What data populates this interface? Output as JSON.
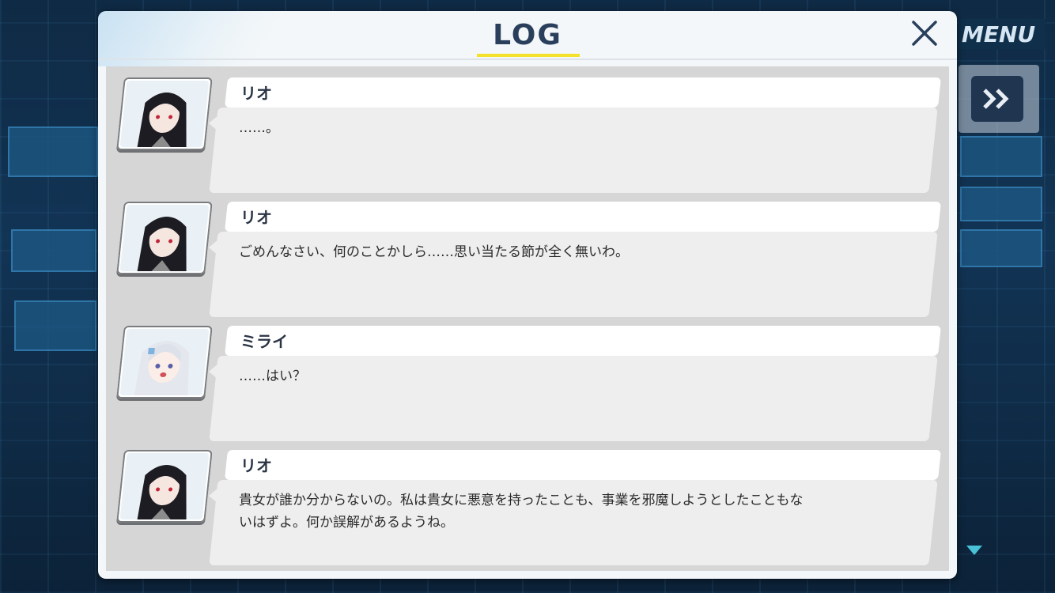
{
  "window": {
    "title": "LOG",
    "close_icon": "close-icon",
    "accent_color": "#f3e12c"
  },
  "background": {
    "menu_label": "MENU",
    "fast_forward_icon": "fast-forward-icon",
    "scroll_indicator_icon": "triangle-down-icon"
  },
  "log": {
    "entries": [
      {
        "speaker": "リオ",
        "text": "……。",
        "portrait": "rio-portrait"
      },
      {
        "speaker": "リオ",
        "text": "ごめんなさい、何のことかしら……思い当たる節が全く無いわ。",
        "portrait": "rio-portrait"
      },
      {
        "speaker": "ミライ",
        "text": "……はい？",
        "portrait": "mirai-portrait"
      },
      {
        "speaker": "リオ",
        "text": "貴女が誰か分からないの。私は貴女に悪意を持ったことも、事業を邪魔しようとしたこともな\nいはずよ。何か誤解があるようね。",
        "portrait": "rio-portrait"
      }
    ]
  }
}
